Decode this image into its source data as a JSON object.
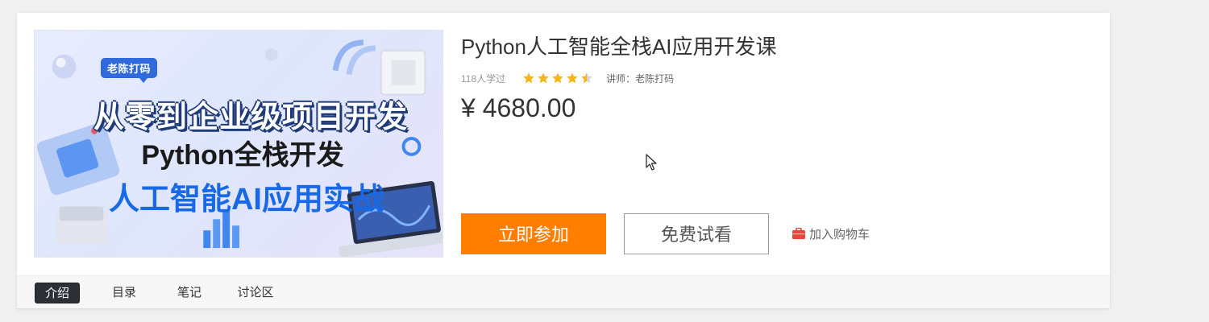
{
  "course": {
    "cover": {
      "tag": "老陈打码",
      "line1": "从零到企业级项目开发",
      "line2": "Python全栈开发",
      "line3": "人工智能AI应用实战"
    },
    "title": "Python人工智能全栈AI应用开发课",
    "learners": "118人学过",
    "rating": 4.5,
    "teacher": "讲师：老陈打码",
    "price": "¥ 4680.00"
  },
  "actions": {
    "join_label": "立即参加",
    "trial_label": "免费试看",
    "cart_label": "加入购物车"
  },
  "tabs": [
    {
      "label": "介绍",
      "active": true
    },
    {
      "label": "目录",
      "active": false
    },
    {
      "label": "笔记",
      "active": false
    },
    {
      "label": "讨论区",
      "active": false
    }
  ],
  "colors": {
    "primary_button": "#ff7e00",
    "star": "#f5b51b",
    "active_tab": "#2b2f36",
    "cart_icon": "#e8483a",
    "cover_accent": "#1869e8"
  },
  "icons": {
    "star": "star-icon",
    "cart": "shopping-bag-icon"
  }
}
